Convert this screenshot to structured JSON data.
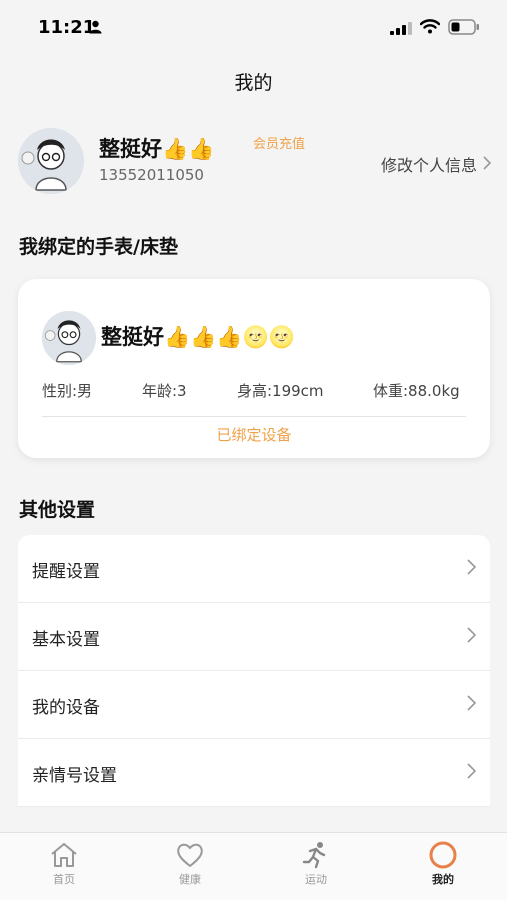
{
  "status_bar": {
    "time": "11:21"
  },
  "nav": {
    "title": "我的"
  },
  "profile": {
    "nickname": "整挺好👍👍",
    "phone": "13552011050",
    "recharge_label": "会员充值",
    "edit_label": "修改个人信息"
  },
  "bound_section": {
    "title": "我绑定的手表/床垫"
  },
  "device": {
    "name": "整挺好👍👍👍🌝🌝",
    "stats": {
      "gender": "性别:男",
      "age": "年龄:3",
      "height": "身高:199cm",
      "weight": "体重:88.0kg"
    },
    "status": "已绑定设备"
  },
  "other_settings": {
    "title": "其他设置",
    "items": [
      {
        "label": "提醒设置"
      },
      {
        "label": "基本设置"
      },
      {
        "label": "我的设备"
      },
      {
        "label": "亲情号设置"
      }
    ]
  },
  "tabbar": {
    "tabs": [
      {
        "label": "首页",
        "icon": "home-icon"
      },
      {
        "label": "健康",
        "icon": "heart-icon"
      },
      {
        "label": "运动",
        "icon": "running-icon"
      },
      {
        "label": "我的",
        "icon": "profile-ring-icon"
      }
    ],
    "active_index": 3
  },
  "colors": {
    "accent": "#f0a24a",
    "ring": "#e8804a",
    "background": "#f4f4f4"
  }
}
